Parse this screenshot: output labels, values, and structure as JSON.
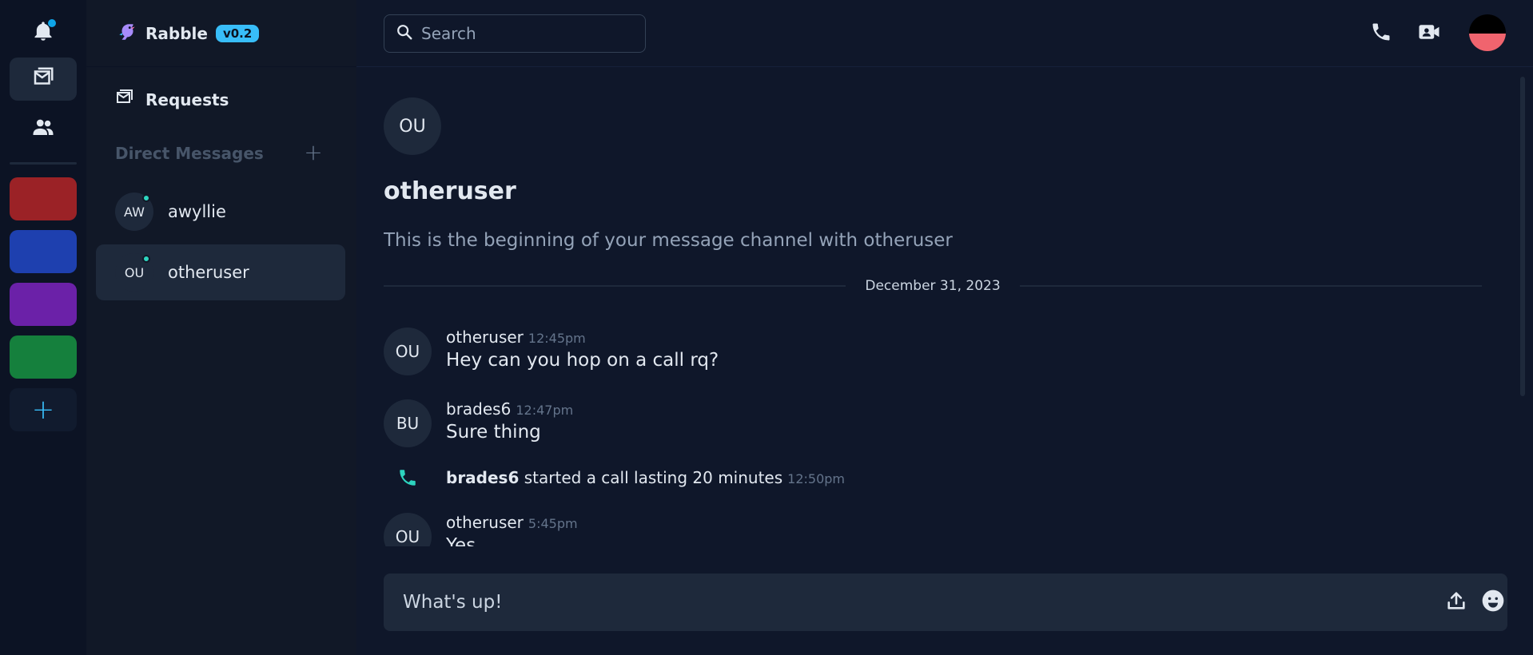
{
  "app": {
    "name": "Rabble",
    "version": "v0.2",
    "logo_icon": "parrot-logo-icon"
  },
  "rail": {
    "items": [
      {
        "name": "notifications",
        "icon": "bell-icon",
        "has_badge": true
      },
      {
        "name": "messages",
        "icon": "mail-stack-icon",
        "active": true
      },
      {
        "name": "friends",
        "icon": "users-icon"
      }
    ],
    "servers": [
      {
        "color": "#9b2226"
      },
      {
        "color": "#1e40af"
      },
      {
        "color": "#6b21a8"
      },
      {
        "color": "#15803d"
      }
    ],
    "add_label": "+"
  },
  "sidebar": {
    "requests_label": "Requests",
    "dm_header": "Direct Messages",
    "dm_add": "+",
    "dms": [
      {
        "initials": "AW",
        "name": "awyllie",
        "online": true,
        "active": false
      },
      {
        "initials": "OU",
        "name": "otheruser",
        "online": true,
        "active": true
      }
    ]
  },
  "topbar": {
    "search_placeholder": "Search",
    "icons": [
      "phone-icon",
      "video-call-icon"
    ]
  },
  "channel": {
    "initials": "OU",
    "name": "otheruser",
    "description": "This is the beginning of your message channel with otheruser",
    "date_separator": "December 31, 2023"
  },
  "messages": [
    {
      "type": "message",
      "initials": "OU",
      "author": "otheruser",
      "time": "12:45pm",
      "text": "Hey can you hop on a call rq?"
    },
    {
      "type": "message",
      "initials": "BU",
      "author": "brades6",
      "time": "12:47pm",
      "text": "Sure thing"
    },
    {
      "type": "system",
      "icon": "phone-icon",
      "actor": "brades6",
      "text": " started a call lasting 20 minutes",
      "time": "12:50pm"
    },
    {
      "type": "message",
      "initials": "OU",
      "author": "otheruser",
      "time": "5:45pm",
      "text": "Yes"
    }
  ],
  "composer": {
    "placeholder": "What's up!",
    "icons": [
      "upload-icon",
      "emoji-icon"
    ]
  },
  "colors": {
    "accent": "#38bdf8",
    "online": "#2dd4bf",
    "call": "#2dd4bf",
    "profile_top": "#000000",
    "profile_bottom": "#f0646e"
  }
}
